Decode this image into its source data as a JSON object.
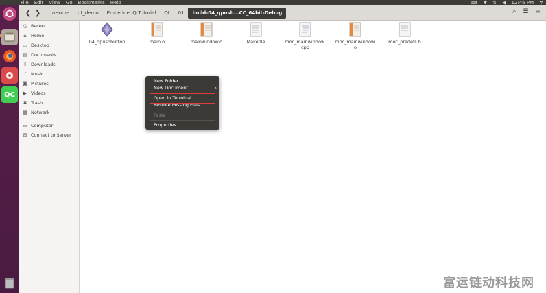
{
  "menubar": {
    "items": [
      "File",
      "Edit",
      "View",
      "Go",
      "Bookmarks",
      "Help"
    ]
  },
  "tray": {
    "time": "12:46 PM"
  },
  "toolbar": {
    "crumbs": [
      "Home",
      "qt_demo",
      "EmbeddedQtTutorial",
      "Qt",
      "01",
      "build-04_qpush...CC_64bit-Debug"
    ]
  },
  "sidebar": {
    "items": [
      "Recent",
      "Home",
      "Desktop",
      "Documents",
      "Downloads",
      "Music",
      "Pictures",
      "Videos",
      "Trash",
      "Network",
      "Computer",
      "Connect to Server"
    ]
  },
  "files": [
    {
      "name": "04_qpushbutton",
      "icon": "executable-icon"
    },
    {
      "name": "main.o",
      "icon": "object-file-icon"
    },
    {
      "name": "mainwindow.o",
      "icon": "object-file-icon"
    },
    {
      "name": "Makefile",
      "icon": "text-file-icon"
    },
    {
      "name": "moc_mainwindow.\ncpp",
      "icon": "source-file-icon"
    },
    {
      "name": "moc_mainwindow.\no",
      "icon": "object-file-icon"
    },
    {
      "name": "moc_predefs.h",
      "icon": "header-file-icon"
    }
  ],
  "context_menu": {
    "items": [
      "New Folder",
      "New Document",
      "Open in Terminal",
      "Restore Missing Files...",
      "Paste",
      "Properties"
    ]
  },
  "watermark": "富运链动科技网",
  "colors": {
    "launcher": "#4a1b42",
    "topbar": "#3c3b37",
    "highlight": "#e03a3a",
    "accent": "#ff8b3d"
  }
}
